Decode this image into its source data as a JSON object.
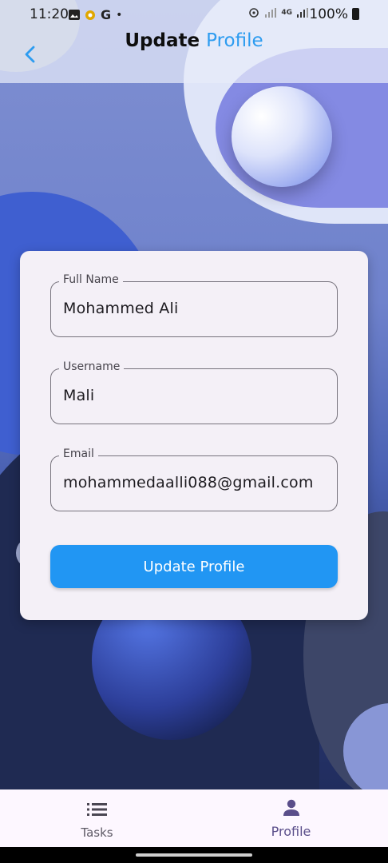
{
  "status_bar": {
    "time": "11:20",
    "network": "4G",
    "battery": "100%"
  },
  "header": {
    "title_part1": "Update",
    "title_part2": "Profile"
  },
  "form": {
    "full_name": {
      "label": "Full Name",
      "value": "Mohammed Ali"
    },
    "username": {
      "label": "Username",
      "value": "Mali"
    },
    "email": {
      "label": "Email",
      "value": "mohammedaalli088@gmail.com"
    },
    "submit_label": "Update Profile"
  },
  "bottom_nav": {
    "items": [
      {
        "label": "Tasks",
        "icon": "list-icon",
        "active": false
      },
      {
        "label": "Profile",
        "icon": "person-icon",
        "active": true
      }
    ]
  },
  "colors": {
    "accent": "#2196f3",
    "title_accent": "#2d9cf0",
    "nav_active": "#5a4e8a"
  }
}
